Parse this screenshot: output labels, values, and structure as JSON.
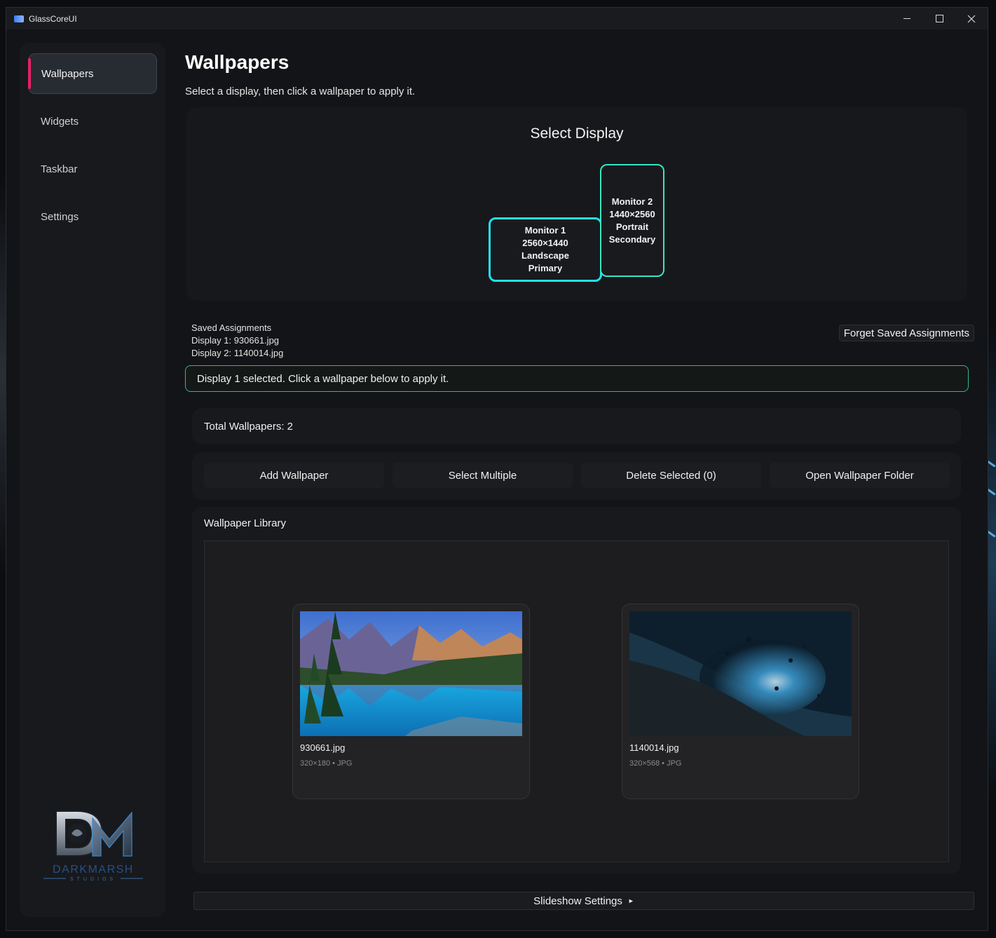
{
  "app": {
    "title": "GlassCoreUI"
  },
  "sidebar": {
    "items": [
      {
        "label": "Wallpapers",
        "active": true
      },
      {
        "label": "Widgets"
      },
      {
        "label": "Taskbar"
      },
      {
        "label": "Settings"
      }
    ],
    "logo": {
      "main": "DARKMARSH",
      "sub": "STUDIOS",
      "initials": "DM"
    }
  },
  "page": {
    "title": "Wallpapers",
    "subtitle": "Select a display, then click a wallpaper to apply it."
  },
  "display_selector": {
    "heading": "Select Display",
    "monitors": [
      {
        "name": "Monitor 1",
        "resolution": "2560×1440",
        "orientation": "Landscape",
        "role": "Primary",
        "selected": true,
        "border_color": "#22e0f0"
      },
      {
        "name": "Monitor 2",
        "resolution": "1440×2560",
        "orientation": "Portrait",
        "role": "Secondary",
        "selected": false,
        "border_color": "#33e7c4"
      }
    ]
  },
  "saved_assignments": {
    "title": "Saved Assignments",
    "lines": [
      "Display 1: 930661.jpg",
      "Display 2: 1140014.jpg"
    ],
    "forget_label": "Forget Saved Assignments"
  },
  "status": {
    "message": "Display 1 selected. Click a wallpaper below to apply it.",
    "border_color": "#2fb98a"
  },
  "total": {
    "label": "Total Wallpapers: 2"
  },
  "actions": [
    {
      "label": "Add Wallpaper"
    },
    {
      "label": "Select Multiple"
    },
    {
      "label": "Delete Selected (0)"
    },
    {
      "label": "Open Wallpaper Folder"
    }
  ],
  "library": {
    "title": "Wallpaper Library",
    "items": [
      {
        "name": "930661.jpg",
        "meta": "320×180 • JPG",
        "thumb": "mountain-lake"
      },
      {
        "name": "1140014.jpg",
        "meta": "320×568 • JPG",
        "thumb": "dark-blue-abstract"
      }
    ]
  },
  "slideshow": {
    "label": "Slideshow Settings",
    "arrow": "►"
  },
  "colors": {
    "accent": "#e91e63",
    "monitor_primary": "#22e0f0",
    "monitor_secondary": "#33e7c4"
  }
}
